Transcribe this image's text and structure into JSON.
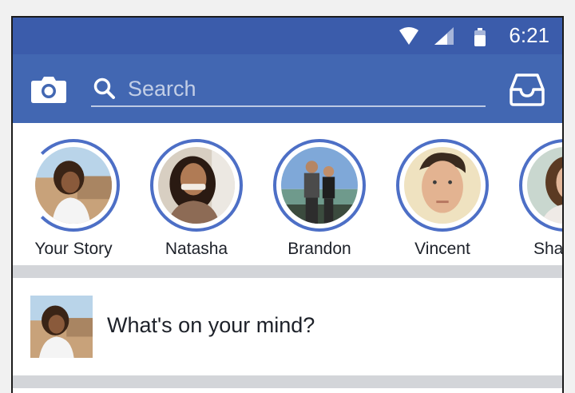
{
  "status_bar": {
    "time": "6:21",
    "icons": [
      "wifi-icon",
      "cellular-signal-icon",
      "battery-icon"
    ]
  },
  "app_bar": {
    "search_placeholder": "Search",
    "icons": [
      "camera-icon",
      "search-icon",
      "inbox-icon"
    ]
  },
  "stories": [
    {
      "name": "Your Story"
    },
    {
      "name": "Natasha"
    },
    {
      "name": "Brandon"
    },
    {
      "name": "Vincent"
    },
    {
      "name": "Sha"
    }
  ],
  "composer": {
    "prompt": "What's on your mind?"
  },
  "colors": {
    "status_bar": "#3b5cab",
    "app_bar": "#4267b2",
    "story_ring": "#4d6fc6",
    "divider": "#d3d5d9",
    "text": "#1d2129"
  }
}
